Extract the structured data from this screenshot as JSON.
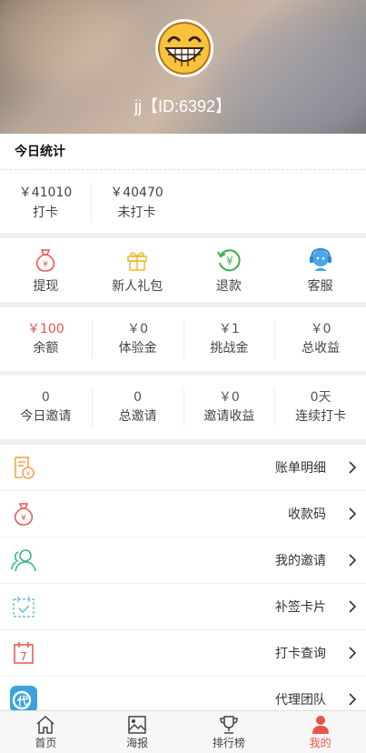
{
  "header": {
    "username": "jj【ID:6392】"
  },
  "stats": {
    "title": "今日统计",
    "items": [
      {
        "value": "￥41010",
        "label": "打卡"
      },
      {
        "value": "￥40470",
        "label": "未打卡"
      }
    ]
  },
  "actions": [
    {
      "label": "提现",
      "icon": "money-bag-icon"
    },
    {
      "label": "新人礼包",
      "icon": "gift-icon"
    },
    {
      "label": "退款",
      "icon": "refund-icon"
    },
    {
      "label": "客服",
      "icon": "customer-service-icon"
    }
  ],
  "balances": [
    {
      "value": "￥100",
      "label": "余额"
    },
    {
      "value": "￥0",
      "label": "体验金"
    },
    {
      "value": "￥1",
      "label": "挑战金"
    },
    {
      "value": "￥0",
      "label": "总收益"
    }
  ],
  "invites": [
    {
      "value": "0",
      "label": "今日邀请"
    },
    {
      "value": "0",
      "label": "总邀请"
    },
    {
      "value": "￥0",
      "label": "邀请收益"
    },
    {
      "value": "0天",
      "label": "连续打卡"
    }
  ],
  "menu": [
    {
      "label": "账单明细",
      "icon": "bill-icon"
    },
    {
      "label": "收款码",
      "icon": "money-bag-icon"
    },
    {
      "label": "我的邀请",
      "icon": "users-icon"
    },
    {
      "label": "补签卡片",
      "icon": "calendar-check-icon"
    },
    {
      "label": "打卡查询",
      "icon": "calendar-icon"
    },
    {
      "label": "代理团队",
      "icon": "agent-icon"
    }
  ],
  "tabbar": [
    {
      "label": "首页",
      "icon": "home-icon"
    },
    {
      "label": "海报",
      "icon": "poster-icon"
    },
    {
      "label": "排行榜",
      "icon": "trophy-icon"
    },
    {
      "label": "我的",
      "icon": "user-icon",
      "active": true
    }
  ],
  "colors": {
    "accent": "#e9544d",
    "gift": "#f5b52b",
    "refund": "#3fae49",
    "service": "#4aa6e8",
    "users": "#39b58b",
    "calendar": "#6fc5d8",
    "bill": "#f0a04b",
    "agent": "#3aa3de"
  }
}
